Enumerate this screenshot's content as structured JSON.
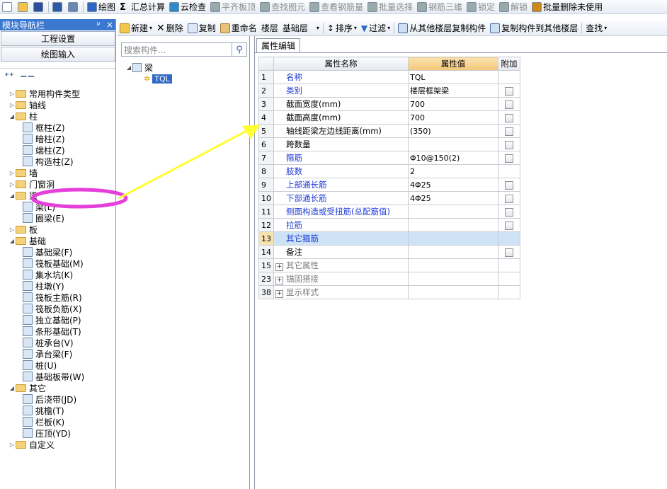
{
  "toolbar1": {
    "items": [
      {
        "label": "",
        "icon": "new-file-icon"
      },
      {
        "label": "",
        "icon": "open-folder-icon"
      },
      {
        "label": "",
        "icon": "save-icon"
      },
      {
        "label": "",
        "icon": "undo-icon"
      },
      {
        "label": "",
        "icon": "redo-icon"
      },
      {
        "label": "绘图",
        "icon": "draw-icon"
      },
      {
        "label": "汇总计算",
        "icon": "sigma-icon"
      },
      {
        "label": "云检查",
        "icon": "cloud-check-icon"
      },
      {
        "label": "平齐板顶",
        "icon": "align-slab-icon",
        "disabled": true
      },
      {
        "label": "查找图元",
        "icon": "find-element-icon",
        "disabled": true
      },
      {
        "label": "查看钢筋量",
        "icon": "view-rebar-icon",
        "disabled": true
      },
      {
        "label": "批量选择",
        "icon": "batch-select-icon",
        "disabled": true
      },
      {
        "label": "钢筋三维",
        "icon": "rebar-3d-icon",
        "disabled": true
      },
      {
        "label": "锁定",
        "icon": "lock-icon",
        "disabled": true
      },
      {
        "label": "解锁",
        "icon": "unlock-icon",
        "disabled": true
      },
      {
        "label": "批量删除未使用",
        "icon": "batch-delete-icon"
      }
    ]
  },
  "nav": {
    "title": "模块导航栏",
    "pin": "ᵖ",
    "close": "×",
    "btn_project": "工程设置",
    "btn_drawing": "绘图输入",
    "tree": [
      {
        "level": 0,
        "tw": "▷",
        "kind": "folder",
        "label": "常用构件类型"
      },
      {
        "level": 0,
        "tw": "▷",
        "kind": "folder",
        "label": "轴线"
      },
      {
        "level": 0,
        "tw": "◢",
        "kind": "folder",
        "label": "柱"
      },
      {
        "level": 1,
        "tw": "",
        "kind": "comp",
        "label": "框柱(Z)"
      },
      {
        "level": 1,
        "tw": "",
        "kind": "comp",
        "label": "暗柱(Z)"
      },
      {
        "level": 1,
        "tw": "",
        "kind": "comp",
        "label": "端柱(Z)"
      },
      {
        "level": 1,
        "tw": "",
        "kind": "comp",
        "label": "构造柱(Z)"
      },
      {
        "level": 0,
        "tw": "▷",
        "kind": "folder",
        "label": "墙"
      },
      {
        "level": 0,
        "tw": "▷",
        "kind": "folder",
        "label": "门窗洞"
      },
      {
        "level": 0,
        "tw": "◢",
        "kind": "folder",
        "label": "梁"
      },
      {
        "level": 1,
        "tw": "",
        "kind": "comp",
        "label": "梁(L)"
      },
      {
        "level": 1,
        "tw": "",
        "kind": "comp",
        "label": "圈梁(E)"
      },
      {
        "level": 0,
        "tw": "▷",
        "kind": "folder",
        "label": "板"
      },
      {
        "level": 0,
        "tw": "◢",
        "kind": "folder",
        "label": "基础"
      },
      {
        "level": 1,
        "tw": "",
        "kind": "comp",
        "label": "基础梁(F)"
      },
      {
        "level": 1,
        "tw": "",
        "kind": "comp",
        "label": "筏板基础(M)"
      },
      {
        "level": 1,
        "tw": "",
        "kind": "comp",
        "label": "集水坑(K)"
      },
      {
        "level": 1,
        "tw": "",
        "kind": "comp",
        "label": "柱墩(Y)"
      },
      {
        "level": 1,
        "tw": "",
        "kind": "comp",
        "label": "筏板主筋(R)"
      },
      {
        "level": 1,
        "tw": "",
        "kind": "comp",
        "label": "筏板负筋(X)"
      },
      {
        "level": 1,
        "tw": "",
        "kind": "comp",
        "label": "独立基础(P)"
      },
      {
        "level": 1,
        "tw": "",
        "kind": "comp",
        "label": "条形基础(T)"
      },
      {
        "level": 1,
        "tw": "",
        "kind": "comp",
        "label": "桩承台(V)"
      },
      {
        "level": 1,
        "tw": "",
        "kind": "comp",
        "label": "承台梁(F)"
      },
      {
        "level": 1,
        "tw": "",
        "kind": "comp",
        "label": "桩(U)"
      },
      {
        "level": 1,
        "tw": "",
        "kind": "comp",
        "label": "基础板带(W)"
      },
      {
        "level": 0,
        "tw": "◢",
        "kind": "folder",
        "label": "其它"
      },
      {
        "level": 1,
        "tw": "",
        "kind": "comp",
        "label": "后浇带(JD)"
      },
      {
        "level": 1,
        "tw": "",
        "kind": "comp",
        "label": "挑檐(T)"
      },
      {
        "level": 1,
        "tw": "",
        "kind": "comp",
        "label": "栏板(K)"
      },
      {
        "level": 1,
        "tw": "",
        "kind": "comp",
        "label": "压顶(YD)"
      },
      {
        "level": 0,
        "tw": "▷",
        "kind": "folder",
        "label": "自定义"
      }
    ]
  },
  "toolbar2": {
    "new": "新建",
    "delete": "删除",
    "copy": "复制",
    "rename": "重命名",
    "floor_label": "楼层",
    "floor_value": "基础层",
    "sort": "排序",
    "filter": "过滤",
    "copy_from": "从其他楼层复制构件",
    "copy_to": "复制构件到其他楼层",
    "find": "查找"
  },
  "component_list": {
    "search_placeholder": "搜索构件...",
    "root": "梁",
    "child": "TQL"
  },
  "props": {
    "tab": "属性编辑",
    "col_name": "属性名称",
    "col_value": "属性值",
    "col_extra": "附加",
    "rows": [
      {
        "n": "1",
        "name": "名称",
        "value": "TQL",
        "blue": true,
        "cb": false
      },
      {
        "n": "2",
        "name": "类别",
        "value": "楼层框架梁",
        "blue": true,
        "cb": true
      },
      {
        "n": "3",
        "name": "截面宽度(mm)",
        "value": "700",
        "blue": false,
        "cb": true
      },
      {
        "n": "4",
        "name": "截面高度(mm)",
        "value": "700",
        "blue": false,
        "cb": true
      },
      {
        "n": "5",
        "name": "轴线距梁左边线距离(mm)",
        "value": "(350)",
        "blue": false,
        "cb": true
      },
      {
        "n": "6",
        "name": "跨数量",
        "value": "",
        "blue": false,
        "cb": true
      },
      {
        "n": "7",
        "name": "箍筋",
        "value": "Φ10@150(2)",
        "blue": true,
        "cb": true
      },
      {
        "n": "8",
        "name": "肢数",
        "value": "2",
        "blue": true,
        "cb": false
      },
      {
        "n": "9",
        "name": "上部通长筋",
        "value": "4Φ25",
        "blue": true,
        "cb": true
      },
      {
        "n": "10",
        "name": "下部通长筋",
        "value": "4Φ25",
        "blue": true,
        "cb": true
      },
      {
        "n": "11",
        "name": "侧面构造或受扭筋(总配筋值)",
        "value": "",
        "blue": true,
        "cb": true
      },
      {
        "n": "12",
        "name": "拉筋",
        "value": "",
        "blue": true,
        "cb": true
      },
      {
        "n": "13",
        "name": "其它箍筋",
        "value": "",
        "blue": true,
        "cb": false,
        "sel": true
      },
      {
        "n": "14",
        "name": "备注",
        "value": "",
        "blue": false,
        "cb": true
      },
      {
        "n": "15",
        "name": "其它属性",
        "value": "",
        "group": true
      },
      {
        "n": "23",
        "name": "锚固搭接",
        "value": "",
        "group": true
      },
      {
        "n": "38",
        "name": "显示样式",
        "value": "",
        "group": true
      }
    ]
  },
  "colors": {
    "accent": "#3b78d0",
    "annotation_arrow": "#ffff33",
    "annotation_ellipse": "#e43fd9"
  }
}
